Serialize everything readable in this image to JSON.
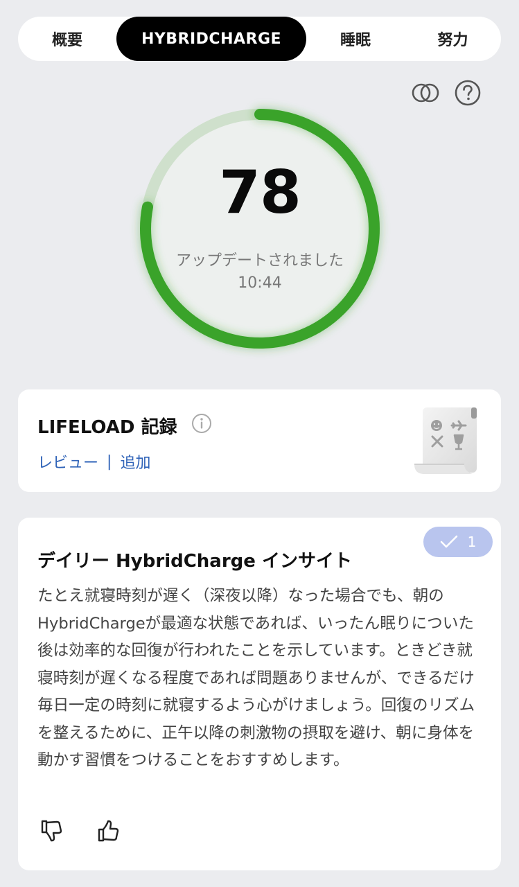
{
  "tabs": [
    {
      "label": "概要"
    },
    {
      "label": "HYBRIDCHARGE"
    },
    {
      "label": "睡眠"
    },
    {
      "label": "努力"
    }
  ],
  "icons": {
    "rings": "overlap-rings-icon",
    "help": "help-icon"
  },
  "gauge": {
    "score": "78",
    "score_fraction": 0.78,
    "updated_label": "アップデートされました",
    "updated_time": "10:44",
    "color": "#3aa32a",
    "track_color": "#cfe0cc"
  },
  "lifeload": {
    "title": "LIFELOAD 記録",
    "review": "レビュー",
    "separator": "|",
    "add": "追加"
  },
  "insight": {
    "badge_count": "1",
    "title": "デイリー HybridCharge インサイト",
    "body": "たとえ就寝時刻が遅く（深夜以降）なった場合でも、朝のHybridChargeが最適な状態であれば、いったん眠りについた後は効率的な回復が行われたことを示しています。ときどき就寝時刻が遅くなる程度であれば問題ありませんが、できるだけ毎日一定の時刻に就寝するよう心がけましょう。回復のリズムを整えるために、正午以降の刺激物の摂取を避け、朝に身体を動かす習慣をつけることをおすすめします。"
  }
}
